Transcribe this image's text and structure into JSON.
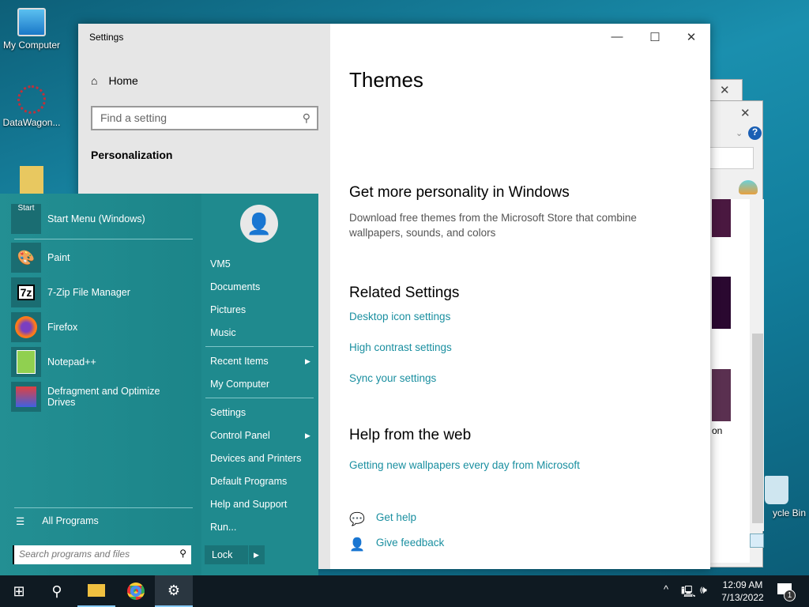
{
  "desktop": {
    "icons": [
      {
        "label": "My Computer"
      },
      {
        "label": "DataWagon..."
      },
      {
        "label": ""
      }
    ],
    "recycle_bin": "ycle Bin"
  },
  "settings": {
    "title": "Settings",
    "home": "Home",
    "search_placeholder": "Find a setting",
    "section": "Personalization",
    "page_title": "Themes",
    "personality": {
      "heading": "Get more personality in Windows",
      "text": "Download free themes from the Microsoft Store that combine wallpapers, sounds, and colors"
    },
    "related": {
      "heading": "Related Settings",
      "links": [
        "Desktop icon settings",
        "High contrast settings",
        "Sync your settings"
      ]
    },
    "web": {
      "heading": "Help from the web",
      "links": [
        "Getting new wallpapers every day from Microsoft"
      ]
    },
    "help": {
      "get_help": "Get help",
      "feedback": "Give feedback"
    }
  },
  "bg_window": {
    "partial_text": "on"
  },
  "start_menu": {
    "pinned": {
      "label": "Start Menu (Windows)",
      "icon_text": "Start"
    },
    "apps": [
      {
        "label": "Paint"
      },
      {
        "label": "7-Zip File Manager",
        "icon_text": "7z"
      },
      {
        "label": "Firefox"
      },
      {
        "label": "Notepad++"
      },
      {
        "label": "Defragment and Optimize Drives"
      }
    ],
    "all_programs": "All Programs",
    "search_placeholder": "Search programs and files",
    "right": {
      "user": "VM5",
      "items1": [
        "Documents",
        "Pictures",
        "Music"
      ],
      "items2": [
        "Recent Items",
        "My Computer"
      ],
      "items3": [
        "Settings",
        "Control Panel",
        "Devices and Printers",
        "Default Programs",
        "Help and Support",
        "Run..."
      ]
    },
    "lock": "Lock"
  },
  "taskbar": {
    "time": "12:09 AM",
    "date": "7/13/2022",
    "notifications": "1"
  }
}
